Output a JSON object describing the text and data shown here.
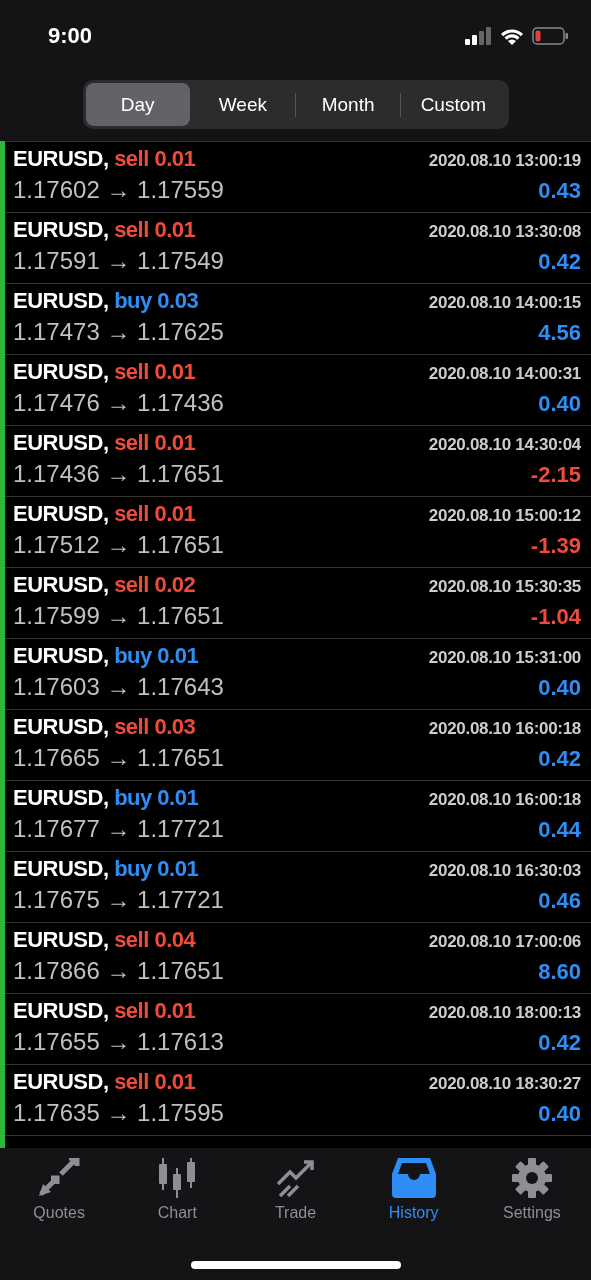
{
  "status_bar": {
    "time": "9:00"
  },
  "periods": [
    {
      "label": "Day",
      "selected": true
    },
    {
      "label": "Week",
      "selected": false
    },
    {
      "label": "Month",
      "selected": false
    },
    {
      "label": "Custom",
      "selected": false
    }
  ],
  "deals": [
    {
      "symbol": "EURUSD,",
      "kind": "sell",
      "action": "sell 0.01",
      "time": "2020.08.10 13:00:19",
      "prices": "1.17602 → 1.17559",
      "profit": "0.43",
      "loss": false
    },
    {
      "symbol": "EURUSD,",
      "kind": "sell",
      "action": "sell 0.01",
      "time": "2020.08.10 13:30:08",
      "prices": "1.17591 → 1.17549",
      "profit": "0.42",
      "loss": false
    },
    {
      "symbol": "EURUSD,",
      "kind": "buy",
      "action": "buy 0.03",
      "time": "2020.08.10 14:00:15",
      "prices": "1.17473 → 1.17625",
      "profit": "4.56",
      "loss": false
    },
    {
      "symbol": "EURUSD,",
      "kind": "sell",
      "action": "sell 0.01",
      "time": "2020.08.10 14:00:31",
      "prices": "1.17476 → 1.17436",
      "profit": "0.40",
      "loss": false
    },
    {
      "symbol": "EURUSD,",
      "kind": "sell",
      "action": "sell 0.01",
      "time": "2020.08.10 14:30:04",
      "prices": "1.17436 → 1.17651",
      "profit": "-2.15",
      "loss": true
    },
    {
      "symbol": "EURUSD,",
      "kind": "sell",
      "action": "sell 0.01",
      "time": "2020.08.10 15:00:12",
      "prices": "1.17512 → 1.17651",
      "profit": "-1.39",
      "loss": true
    },
    {
      "symbol": "EURUSD,",
      "kind": "sell",
      "action": "sell 0.02",
      "time": "2020.08.10 15:30:35",
      "prices": "1.17599 → 1.17651",
      "profit": "-1.04",
      "loss": true
    },
    {
      "symbol": "EURUSD,",
      "kind": "buy",
      "action": "buy 0.01",
      "time": "2020.08.10 15:31:00",
      "prices": "1.17603 → 1.17643",
      "profit": "0.40",
      "loss": false
    },
    {
      "symbol": "EURUSD,",
      "kind": "sell",
      "action": "sell 0.03",
      "time": "2020.08.10 16:00:18",
      "prices": "1.17665 → 1.17651",
      "profit": "0.42",
      "loss": false
    },
    {
      "symbol": "EURUSD,",
      "kind": "buy",
      "action": "buy 0.01",
      "time": "2020.08.10 16:00:18",
      "prices": "1.17677 → 1.17721",
      "profit": "0.44",
      "loss": false
    },
    {
      "symbol": "EURUSD,",
      "kind": "buy",
      "action": "buy 0.01",
      "time": "2020.08.10 16:30:03",
      "prices": "1.17675 → 1.17721",
      "profit": "0.46",
      "loss": false
    },
    {
      "symbol": "EURUSD,",
      "kind": "sell",
      "action": "sell 0.04",
      "time": "2020.08.10 17:00:06",
      "prices": "1.17866 → 1.17651",
      "profit": "8.60",
      "loss": false
    },
    {
      "symbol": "EURUSD,",
      "kind": "sell",
      "action": "sell 0.01",
      "time": "2020.08.10 18:00:13",
      "prices": "1.17655 → 1.17613",
      "profit": "0.42",
      "loss": false
    },
    {
      "symbol": "EURUSD,",
      "kind": "sell",
      "action": "sell 0.01",
      "time": "2020.08.10 18:30:27",
      "prices": "1.17635 → 1.17595",
      "profit": "0.40",
      "loss": false
    }
  ],
  "tab_bar": [
    {
      "label": "Quotes",
      "kind": "quotes",
      "selected": false
    },
    {
      "label": "Chart",
      "kind": "chart",
      "selected": false
    },
    {
      "label": "Trade",
      "kind": "trade",
      "selected": false
    },
    {
      "label": "History",
      "kind": "history",
      "selected": true
    },
    {
      "label": "Settings",
      "kind": "settings",
      "selected": false
    }
  ]
}
